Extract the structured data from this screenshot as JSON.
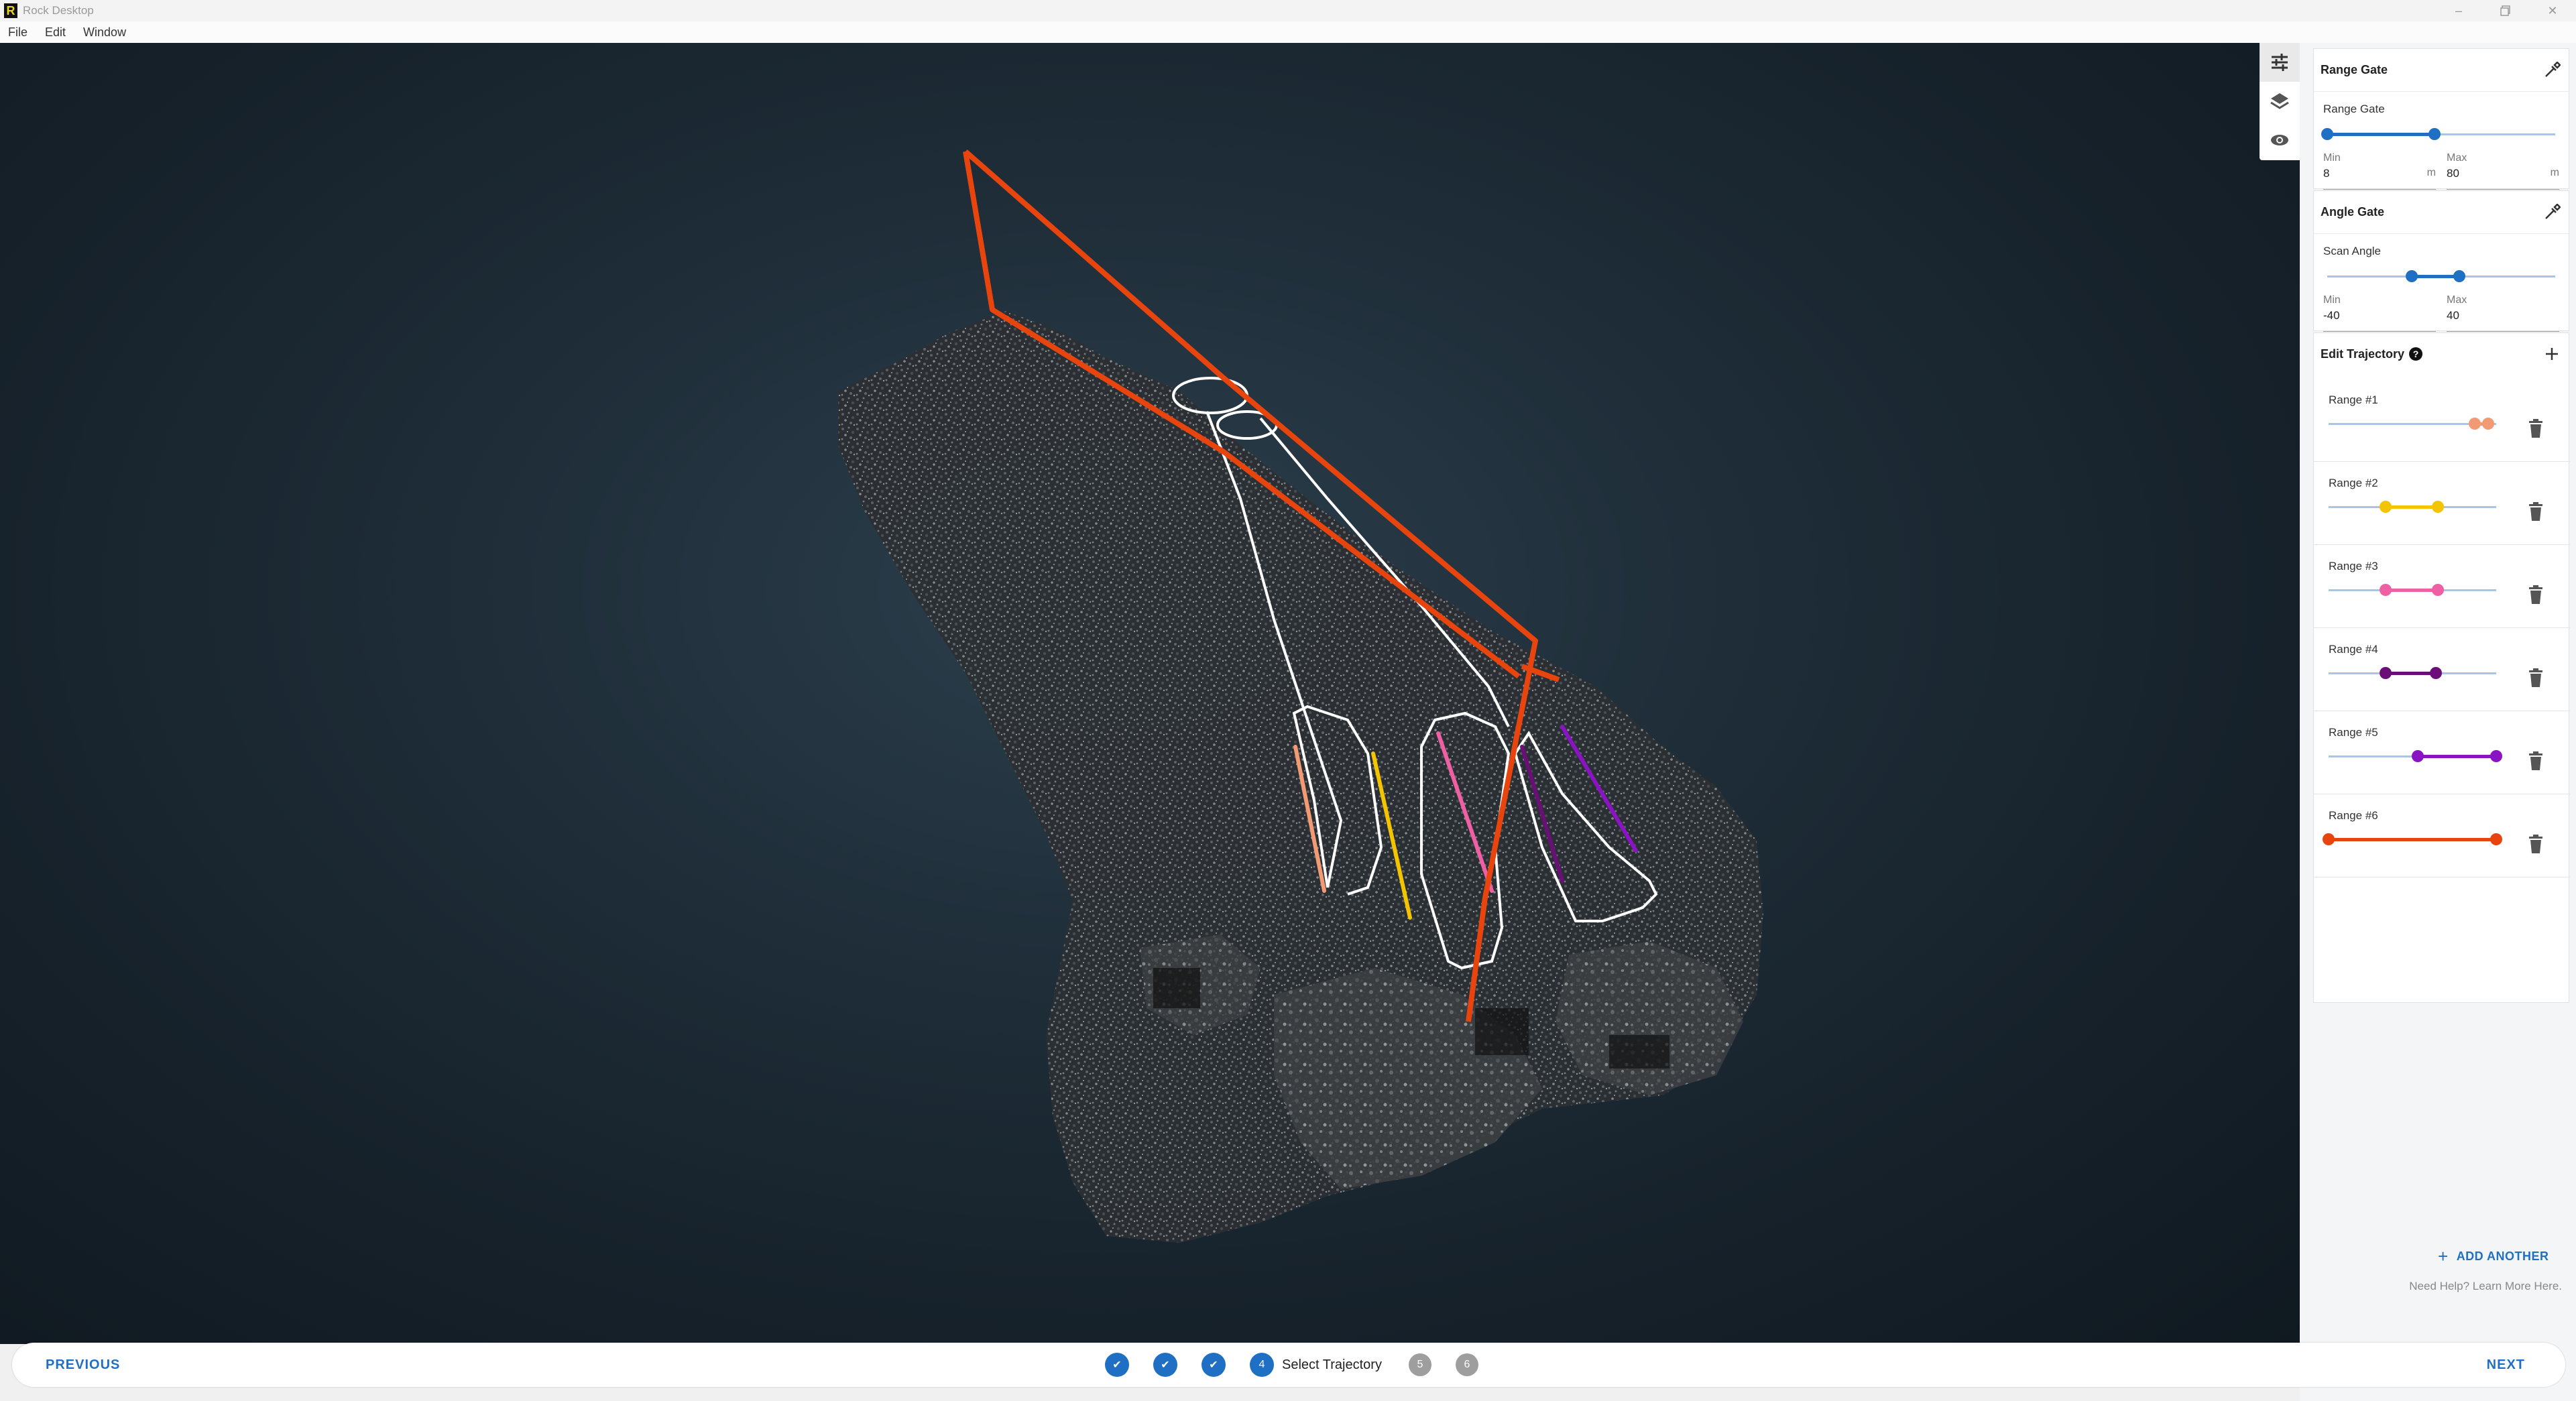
{
  "app": {
    "title": "Rock Desktop",
    "logo_letter": "R"
  },
  "menu": [
    "File",
    "Edit",
    "Window"
  ],
  "window_controls": [
    "minimize-icon",
    "restore-icon",
    "close-icon"
  ],
  "toolstrip": [
    {
      "icon": "sliders-icon",
      "active": true
    },
    {
      "icon": "layers-icon",
      "active": false
    },
    {
      "icon": "eye-icon",
      "active": false
    }
  ],
  "range_gate": {
    "title": "Range Gate",
    "slider_label": "Range Gate",
    "min_label": "Min",
    "min_value": "8",
    "min_unit": "m",
    "max_label": "Max",
    "max_value": "80",
    "max_unit": "m",
    "low_fraction": 0.0,
    "high_fraction": 0.47
  },
  "angle_gate": {
    "title": "Angle Gate",
    "slider_label": "Scan Angle",
    "min_label": "Min",
    "min_value": "-40",
    "max_label": "Max",
    "max_value": "40",
    "low_fraction": 0.37,
    "high_fraction": 0.58
  },
  "edit_trajectory": {
    "title": "Edit Trajectory",
    "ranges": [
      {
        "label": "Range #1",
        "color": "#f19a74",
        "low": 0.87,
        "high": 0.95
      },
      {
        "label": "Range #2",
        "color": "#f3c400",
        "low": 0.34,
        "high": 0.65
      },
      {
        "label": "Range #3",
        "color": "#ee5fa4",
        "low": 0.34,
        "high": 0.65
      },
      {
        "label": "Range #4",
        "color": "#6a0f78",
        "low": 0.34,
        "high": 0.64
      },
      {
        "label": "Range #5",
        "color": "#8a13c4",
        "low": 0.53,
        "high": 1.0
      },
      {
        "label": "Range #6",
        "color": "#e8440e",
        "low": 0.0,
        "high": 1.0
      }
    ],
    "add_label": "ADD ANOTHER",
    "help_text": "Need Help? Learn More Here."
  },
  "footer": {
    "previous": "PREVIOUS",
    "next": "NEXT",
    "steps": [
      {
        "state": "done"
      },
      {
        "state": "done"
      },
      {
        "state": "done"
      },
      {
        "state": "current",
        "number": "4",
        "label": "Select Trajectory"
      },
      {
        "state": "future",
        "number": "5"
      },
      {
        "state": "future",
        "number": "6"
      }
    ]
  }
}
